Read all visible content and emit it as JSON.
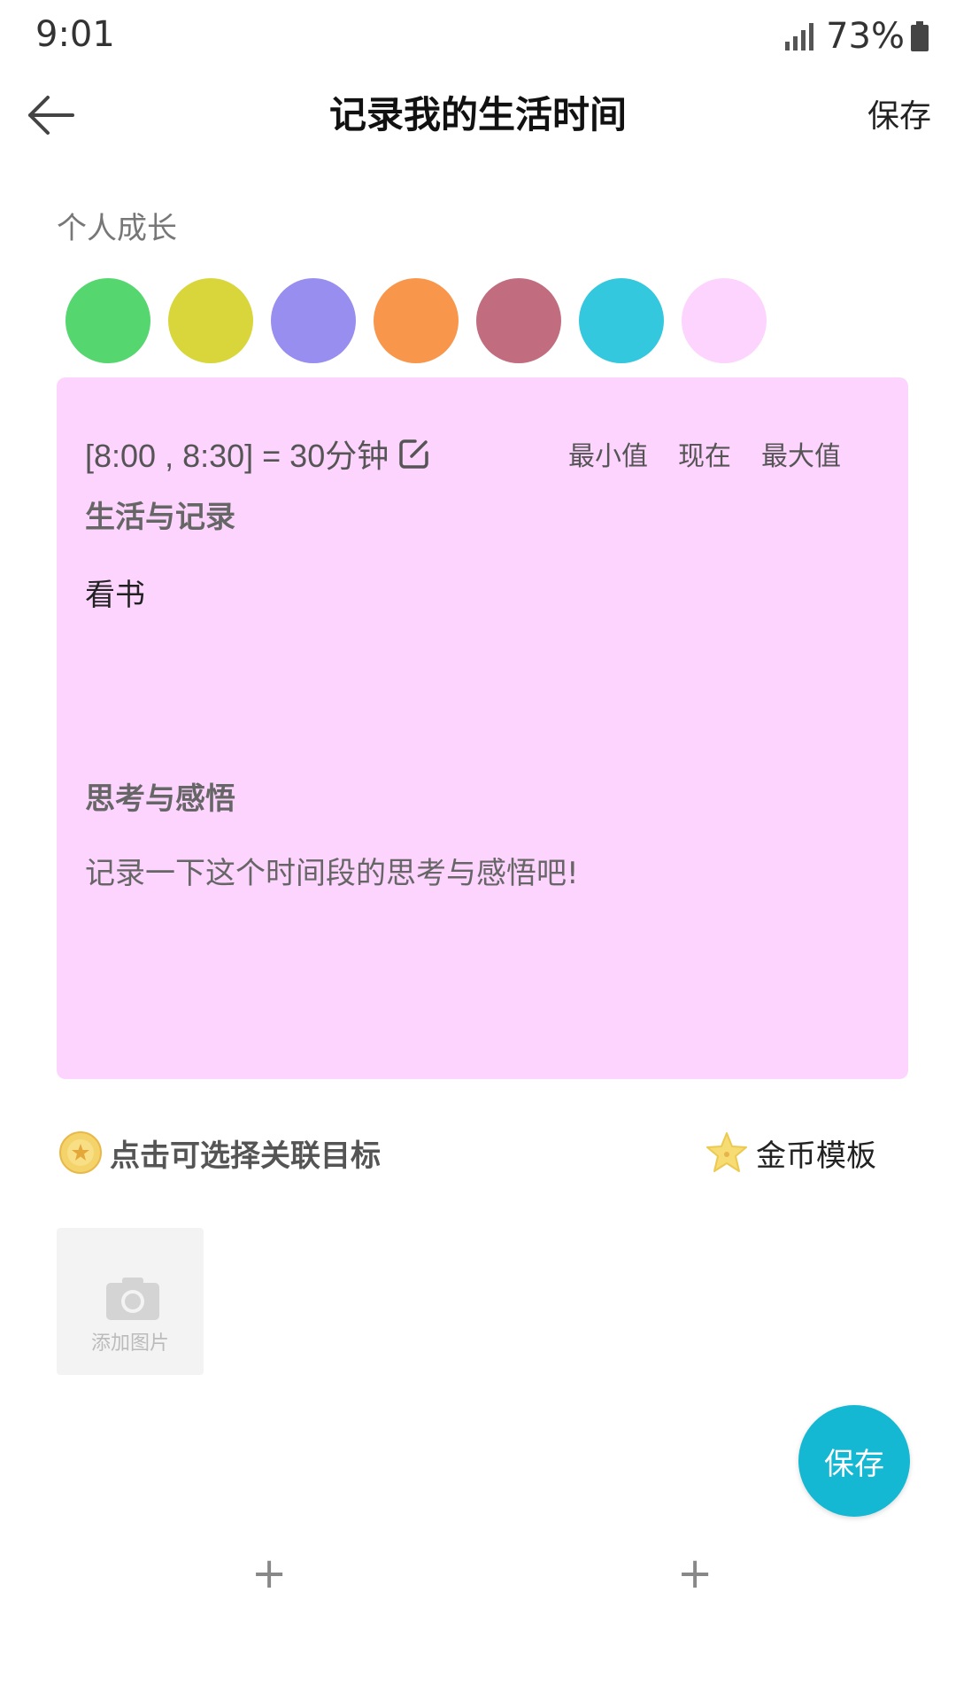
{
  "status_bar": {
    "time": "9:01",
    "battery": "73%"
  },
  "nav": {
    "title": "记录我的生活时间",
    "save_label": "保存"
  },
  "category": {
    "label": "个人成长"
  },
  "swatches": [
    {
      "name": "green",
      "color": "#55d66e"
    },
    {
      "name": "yellow",
      "color": "#d8d63a"
    },
    {
      "name": "purple",
      "color": "#978ef0"
    },
    {
      "name": "orange",
      "color": "#f8974c"
    },
    {
      "name": "rose",
      "color": "#c26d7f"
    },
    {
      "name": "cyan",
      "color": "#33c8dd"
    },
    {
      "name": "pink",
      "color": "#fdd4fe"
    }
  ],
  "card": {
    "background": "#fdd4fe",
    "time_range": "[8:00 , 8:30] = 30分钟",
    "actions": {
      "min": "最小值",
      "now": "现在",
      "max": "最大值"
    },
    "life_heading": "生活与记录",
    "life_text": "看书",
    "thought_heading": "思考与感悟",
    "thought_placeholder": "记录一下这个时间段的思考与感悟吧!"
  },
  "goal": {
    "text": "点击可选择关联目标"
  },
  "coin_template": {
    "text": "金币模板"
  },
  "photo": {
    "add_label": "添加图片"
  },
  "fab": {
    "label": "保存",
    "color": "#15b8d2"
  },
  "bottom": {
    "plus_left": "+",
    "plus_right": "+"
  }
}
